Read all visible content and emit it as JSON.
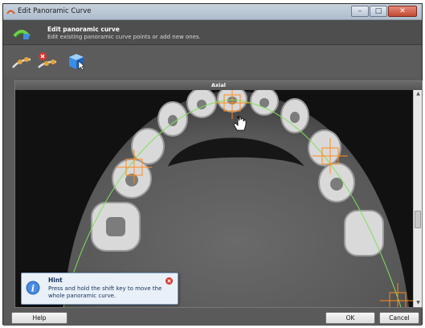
{
  "window": {
    "title": "Edit Panoramic Curve"
  },
  "header": {
    "title": "Edit panoramic curve",
    "subtitle": "Edit existing panoramic curve points or add new ones."
  },
  "toolbar": {
    "tools": [
      {
        "icon": "edit-curve-icon"
      },
      {
        "icon": "delete-curve-icon"
      },
      {
        "icon": "3d-cube-cursor-icon"
      }
    ]
  },
  "view": {
    "title": "Axial"
  },
  "hint": {
    "title": "Hint",
    "text": "Press and hold the shift key to move the whole panoramic curve."
  },
  "buttons": {
    "help": "Help",
    "ok": "OK",
    "cancel": "Cancel"
  },
  "colors": {
    "curve": "#7fe05a",
    "marker": "#ff8a1c",
    "header_bg": "#4e4e4e",
    "hint_bg": "#e9f0f8"
  }
}
